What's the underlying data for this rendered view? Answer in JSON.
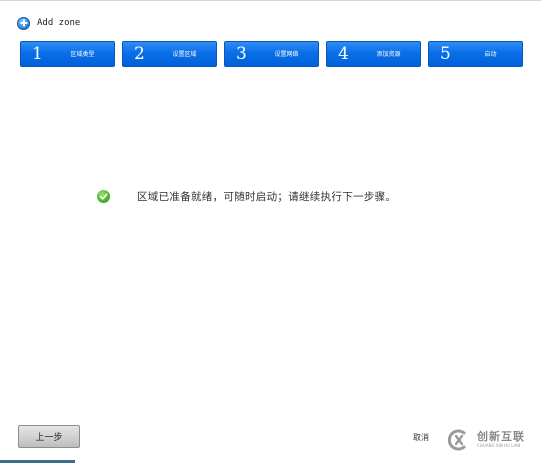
{
  "header": {
    "title": "Add zone",
    "icon": "add-circle-icon"
  },
  "steps": [
    {
      "number": "1",
      "label": "区域类型"
    },
    {
      "number": "2",
      "label": "设置区域"
    },
    {
      "number": "3",
      "label": "设置网络"
    },
    {
      "number": "4",
      "label": "添加资源"
    },
    {
      "number": "5",
      "label": "启动"
    }
  ],
  "message": {
    "icon": "check-circle-icon",
    "text": "区域已准备就绪，可随时启动；请继续执行下一步骤。"
  },
  "footer": {
    "back_label": "上一步",
    "cancel_label": "取消"
  },
  "watermark": {
    "brand_cn": "创新互联",
    "brand_en": "CHUANG XIN HU LIAN"
  },
  "colors": {
    "step_blue": "#0a6fe8",
    "success_green": "#4bb02a"
  }
}
